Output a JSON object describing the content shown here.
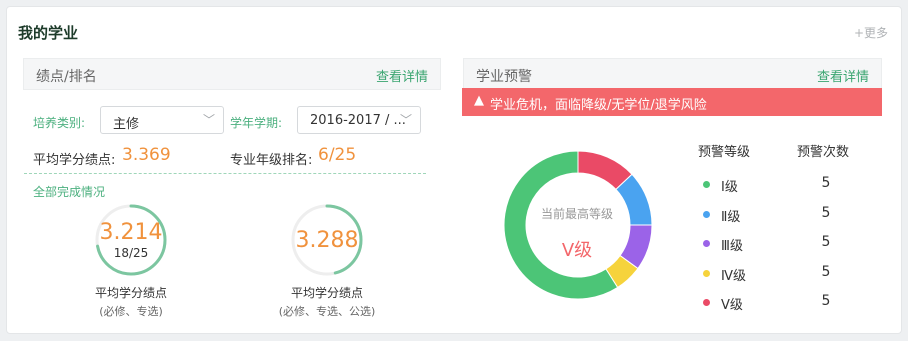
{
  "header": {
    "title": "我的学业",
    "more": "+更多"
  },
  "gpa_panel": {
    "title": "绩点/排名",
    "link": "查看详情",
    "type_label": "培养类别:",
    "type_value": "主修",
    "term_label": "学年学期:",
    "term_value": "2016-2017 / ...",
    "avg_label": "平均学分绩点:",
    "avg_value": "3.369",
    "rank_label": "专业年级排名:",
    "rank_value": "6/25",
    "completion_label": "全部完成情况",
    "gauges": [
      {
        "value": "3.214",
        "sub": "18/25",
        "caption": "平均学分绩点",
        "note": "(必修、专选)",
        "progress": 0.72,
        "color": "#7cc6a0"
      },
      {
        "value": "3.288",
        "sub": "",
        "caption": "平均学分绩点",
        "note": "(必修、专选、公选)",
        "progress": 0.46,
        "color": "#7cc6a0"
      }
    ]
  },
  "warning_panel": {
    "title": "学业预警",
    "link": "查看详情",
    "alert_icon": "warning-triangle-icon",
    "alert_text": "学业危机，面临降级/无学位/退学风险",
    "center_label": "当前最高等级",
    "center_value": "Ⅴ级",
    "col_level": "预警等级",
    "col_count": "预警次数",
    "levels": [
      {
        "label": "Ⅰ级",
        "count": "5",
        "color": "#4cc577"
      },
      {
        "label": "Ⅱ级",
        "count": "5",
        "color": "#4aa3f0"
      },
      {
        "label": "Ⅲ级",
        "count": "5",
        "color": "#9b63e8"
      },
      {
        "label": "Ⅳ级",
        "count": "5",
        "color": "#f6d33c"
      },
      {
        "label": "Ⅴ级",
        "count": "5",
        "color": "#ea4a66"
      }
    ],
    "donut_segments": [
      {
        "name": "Ⅴ级",
        "value": 0.13,
        "color": "#ea4a66"
      },
      {
        "name": "Ⅱ级",
        "value": 0.12,
        "color": "#4aa3f0"
      },
      {
        "name": "Ⅲ级",
        "value": 0.1,
        "color": "#9b63e8"
      },
      {
        "name": "Ⅳ级",
        "value": 0.06,
        "color": "#f6d33c"
      },
      {
        "name": "Ⅰ级",
        "value": 0.59,
        "color": "#4cc577"
      }
    ]
  }
}
